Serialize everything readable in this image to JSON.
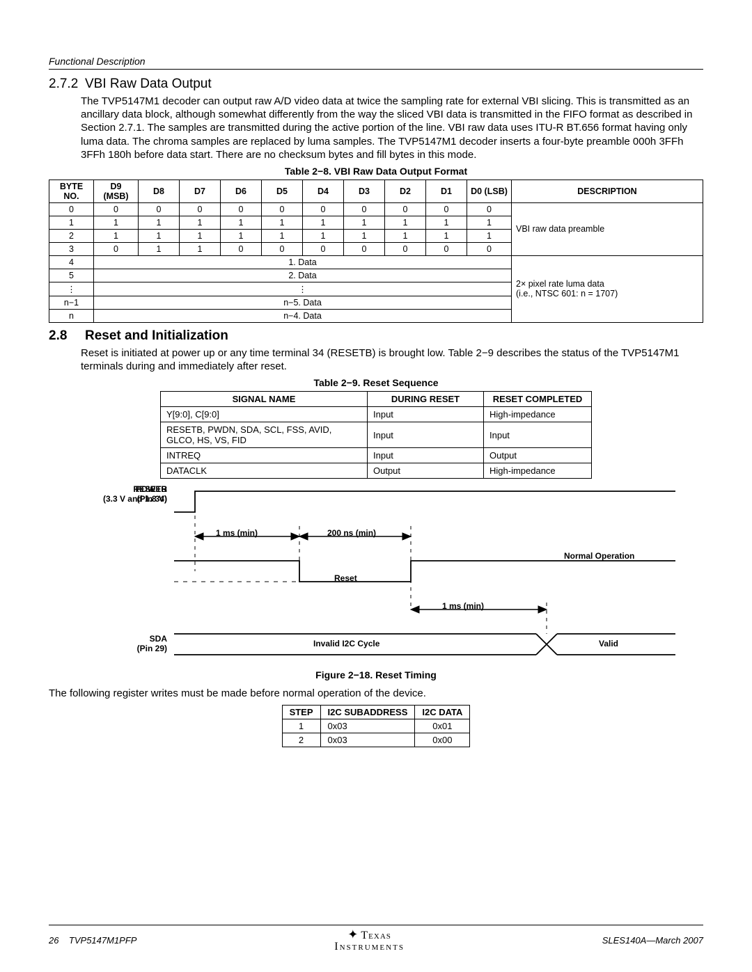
{
  "header": {
    "section_label": "Functional Description"
  },
  "s272": {
    "num": "2.7.2",
    "title": "VBI Raw Data Output",
    "para": "The TVP5147M1 decoder can output raw A/D video data at twice the sampling rate for external VBI slicing. This is transmitted as an ancillary data block, although somewhat differently from the way the sliced VBI data is transmitted in the FIFO format as described in Section 2.7.1. The samples are transmitted during the active portion of the line. VBI raw data uses ITU-R BT.656 format having only luma data. The chroma samples are replaced by luma samples. The TVP5147M1 decoder inserts a four-byte preamble 000h 3FFh 3FFh 180h before data start. There are no checksum bytes and fill bytes in this mode."
  },
  "table28": {
    "caption": "Table 2−8.  VBI Raw Data Output Format",
    "head": [
      "BYTE NO.",
      "D9 (MSB)",
      "D8",
      "D7",
      "D6",
      "D5",
      "D4",
      "D3",
      "D2",
      "D1",
      "D0 (LSB)",
      "DESCRIPTION"
    ],
    "preamble_rows": [
      {
        "byte": "0",
        "bits": [
          "0",
          "0",
          "0",
          "0",
          "0",
          "0",
          "0",
          "0",
          "0",
          "0"
        ]
      },
      {
        "byte": "1",
        "bits": [
          "1",
          "1",
          "1",
          "1",
          "1",
          "1",
          "1",
          "1",
          "1",
          "1"
        ]
      },
      {
        "byte": "2",
        "bits": [
          "1",
          "1",
          "1",
          "1",
          "1",
          "1",
          "1",
          "1",
          "1",
          "1"
        ]
      },
      {
        "byte": "3",
        "bits": [
          "0",
          "1",
          "1",
          "0",
          "0",
          "0",
          "0",
          "0",
          "0",
          "0"
        ]
      }
    ],
    "preamble_desc": "VBI raw data preamble",
    "data_rows": [
      {
        "byte": "4",
        "label": "1. Data"
      },
      {
        "byte": "5",
        "label": "2. Data"
      },
      {
        "byte": "⋮",
        "label": "⋮"
      },
      {
        "byte": "n−1",
        "label": "n−5. Data"
      },
      {
        "byte": "n",
        "label": "n−4. Data"
      }
    ],
    "data_desc1": "2× pixel rate luma data",
    "data_desc2": "(i.e., NTSC 601: n = 1707)"
  },
  "s28": {
    "num": "2.8",
    "title": "Reset and Initialization",
    "para": "Reset is initiated at power up or any time terminal 34 (RESETB) is brought low. Table 2−9 describes the status of the TVP5147M1 terminals during and immediately after reset."
  },
  "table29": {
    "caption": "Table 2−9.  Reset Sequence",
    "head": [
      "SIGNAL NAME",
      "DURING RESET",
      "RESET COMPLETED"
    ],
    "rows": [
      [
        "Y[9:0], C[9:0]",
        "Input",
        "High-impedance"
      ],
      [
        "RESETB, PWDN, SDA, SCL, FSS, AVID, GLCO, HS, VS, FID",
        "Input",
        "Input"
      ],
      [
        "INTREQ",
        "Input",
        "Output"
      ],
      [
        "DATACLK",
        "Output",
        "High-impedance"
      ]
    ]
  },
  "timing": {
    "power_label1": "POWER",
    "power_label2": "(3.3 V and 1.8 V)",
    "resetb_label1": "RESETB",
    "resetb_label2": "(Pin 34)",
    "sda_label1": "SDA",
    "sda_label2": "(Pin 29)",
    "t_1ms_a": "1 ms (min)",
    "t_200ns": "200 ns (min)",
    "t_1ms_b": "1 ms (min)",
    "reset_text": "Reset",
    "normal_op": "Normal Operation",
    "invalid_i2c": "Invalid I2C Cycle",
    "valid": "Valid",
    "caption": "Figure 2−18.  Reset Timing"
  },
  "post_fig_para": "The following register writes must be made before normal operation of the device.",
  "table_init": {
    "head": [
      "STEP",
      "I2C SUBADDRESS",
      "I2C DATA"
    ],
    "rows": [
      [
        "1",
        "0x03",
        "0x01"
      ],
      [
        "2",
        "0x03",
        "0x00"
      ]
    ]
  },
  "footer": {
    "page": "26",
    "part": "TVP5147M1PFP",
    "docid": "SLES140A—March 2007",
    "logo1": "Texas",
    "logo2": "Instruments"
  }
}
